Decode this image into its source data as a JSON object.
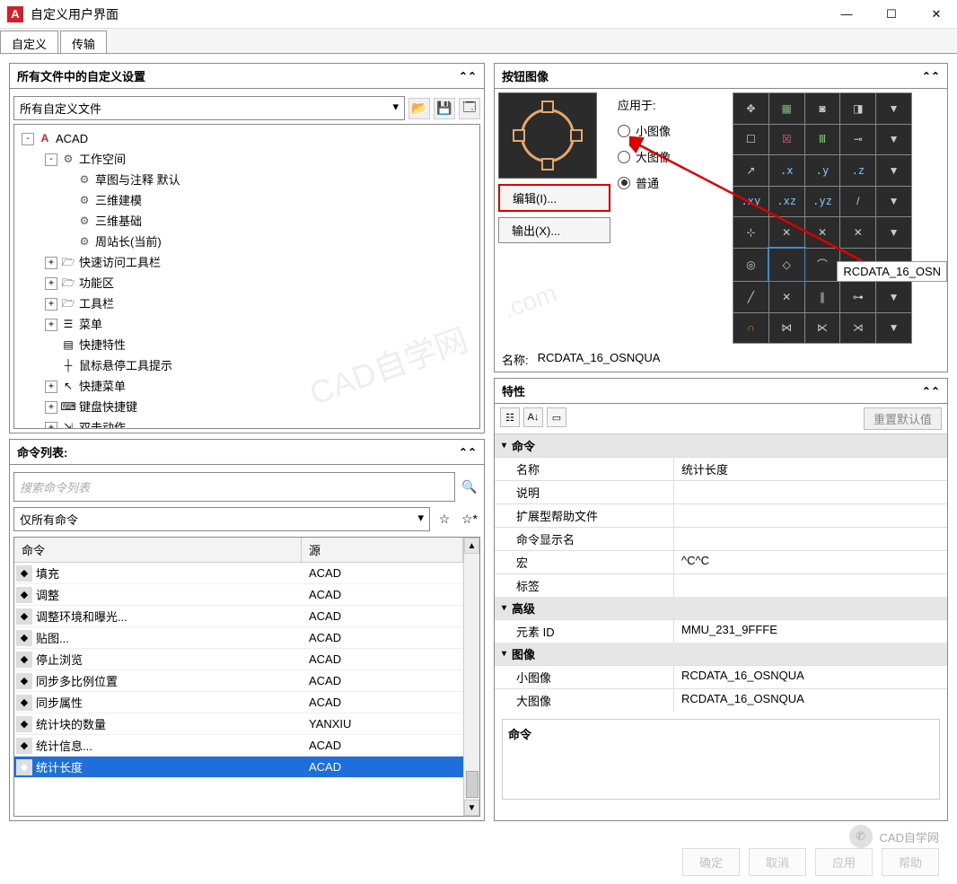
{
  "window": {
    "title": "自定义用户界面"
  },
  "tabs": {
    "customize": "自定义",
    "transfer": "传输"
  },
  "left": {
    "settings_panel": {
      "title": "所有文件中的自定义设置"
    },
    "file_dropdown": "所有自定义文件",
    "tree": {
      "root": "ACAD",
      "workspace": "工作空间",
      "ws_items": [
        "草图与注释  默认",
        "三维建模",
        "三维基础",
        "周站长(当前)"
      ],
      "quick_access": "快速访问工具栏",
      "ribbon": "功能区",
      "toolbars": "工具栏",
      "menus": "菜单",
      "quick_props": "快捷特性",
      "rollover": "鼠标悬停工具提示",
      "shortcut_menus": "快捷菜单",
      "keyboard": "键盘快捷键",
      "dblclick": "双击动作"
    },
    "cmd_panel": {
      "title": "命令列表:",
      "search_placeholder": "搜索命令列表",
      "filter": "仅所有命令",
      "col_cmd": "命令",
      "col_src": "源",
      "rows": [
        {
          "name": "填充",
          "src": "ACAD"
        },
        {
          "name": "调整",
          "src": "ACAD"
        },
        {
          "name": "调整环境和曝光...",
          "src": "ACAD"
        },
        {
          "name": "贴图...",
          "src": "ACAD"
        },
        {
          "name": "停止浏览",
          "src": "ACAD"
        },
        {
          "name": "同步多比例位置",
          "src": "ACAD"
        },
        {
          "name": "同步属性",
          "src": "ACAD"
        },
        {
          "name": "统计块的数量",
          "src": "YANXIU"
        },
        {
          "name": "统计信息...",
          "src": "ACAD"
        },
        {
          "name": "统计长度",
          "src": "ACAD"
        }
      ]
    }
  },
  "right": {
    "btnimg": {
      "title": "按钮图像",
      "edit": "编辑(I)...",
      "export": "输出(X)...",
      "apply_label": "应用于:",
      "radio_small": "小图像",
      "radio_large": "大图像",
      "radio_both": "普通",
      "name_label": "名称:",
      "name_value": "RCDATA_16_OSNQUA",
      "tooltip": "RCDATA_16_OSN",
      "grid_labels": {
        "x": ".x",
        "y": ".y",
        "z": ".z",
        "xy": ".xy",
        "xz": ".xz",
        "yz": ".yz"
      }
    },
    "props": {
      "title": "特性",
      "reset": "重置默认值",
      "cat_cmd": "命令",
      "rows_cmd": {
        "name": {
          "label": "名称",
          "value": "统计长度"
        },
        "desc": {
          "label": "说明",
          "value": ""
        },
        "exthelp": {
          "label": "扩展型帮助文件",
          "value": ""
        },
        "dispname": {
          "label": "命令显示名",
          "value": ""
        },
        "macro": {
          "label": "宏",
          "value": "^C^C"
        },
        "tag": {
          "label": "标签",
          "value": ""
        }
      },
      "cat_adv": "高级",
      "rows_adv": {
        "eid": {
          "label": "元素 ID",
          "value": "MMU_231_9FFFE"
        }
      },
      "cat_img": "图像",
      "rows_img": {
        "small": {
          "label": "小图像",
          "value": "RCDATA_16_OSNQUA"
        },
        "large": {
          "label": "大图像",
          "value": "RCDATA_16_OSNQUA"
        }
      },
      "footer": "命令"
    }
  },
  "footer": {
    "ok": "确定",
    "cancel": "取消",
    "apply": "应用",
    "help": "帮助"
  },
  "badge": "CAD自学网"
}
